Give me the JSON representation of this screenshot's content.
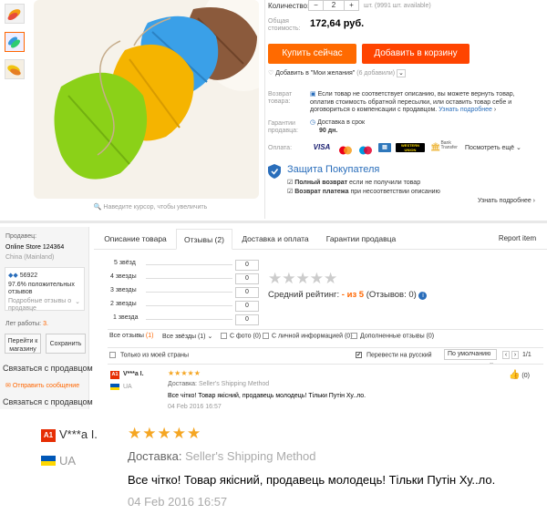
{
  "gallery": {
    "zoom_hint": "Наведите курсор, чтобы увеличить"
  },
  "purchase": {
    "qty_label": "Количество:",
    "qty_value": "2",
    "qty_minus": "−",
    "qty_plus": "+",
    "qty_avail": "шт. (9991 шт. available)",
    "total_label_1": "Общая",
    "total_label_2": "стоимость:",
    "total_value": "172,64 руб.",
    "buy_now": "Купить сейчас",
    "add_to_cart": "Добавить в корзину",
    "wishlist": "Добавить в \"Мои желания\"",
    "wishlist_count": "(6 добавили)",
    "return_label_1": "Возврат",
    "return_label_2": "товара:",
    "return_text_1": "Если товар не соответствует описанию, вы можете вернуть товар,",
    "return_text_2": "оплатив стоимость обратной пересылки, или оставить товар себе и",
    "return_text_3": "договориться о компенсации с продавцом.",
    "return_more": "Узнать подробнее",
    "guarantee_label_1": "Гарантии",
    "guarantee_label_2": "продавца:",
    "guarantee_text": "Доставка в срок",
    "guarantee_days": "90 дн.",
    "payment_label": "Оплата:",
    "payment_more": "Посмотреть ещё",
    "pay_visa": "VISA",
    "pay_wu": "WESTERN UNION",
    "pay_bank": "Bank Transfer",
    "protection_title": "Защита Покупателя",
    "protection_item1_bold": "Полный возврат",
    "protection_item1_rest": "если не получили товар",
    "protection_item2_bold": "Возврат платежа",
    "protection_item2_rest": "при несоответствии описанию",
    "protection_more": "Узнать подробнее"
  },
  "seller": {
    "label": "Продавец:",
    "name": "Online Store 124364",
    "location": "China (Mainland)",
    "score": "56922",
    "positive_pct": "97.6%",
    "positive_text_1": "положительных",
    "positive_text_2": "отзывов",
    "details_1": "Подробные отзывы о",
    "details_2": "продавце",
    "years_label": "Лет работы:",
    "years_value": "3",
    "goto_store_1": "Перейти к",
    "goto_store_2": "магазину",
    "save": "Сохранить",
    "contact": "Связаться с продавцом",
    "send_message": "Отправить сообщение",
    "contact2": "Связаться с продавцом"
  },
  "tabs": {
    "description": "Описание товара",
    "reviews": "Отзывы (2)",
    "shipping": "Доставка и оплата",
    "guarantees": "Гарантии продавца",
    "report": "Report item"
  },
  "ratings": {
    "rows": [
      {
        "label": "5 звёзд",
        "count": "0"
      },
      {
        "label": "4 звезды",
        "count": "0"
      },
      {
        "label": "3 звезды",
        "count": "0"
      },
      {
        "label": "2 звезды",
        "count": "0"
      },
      {
        "label": "1 звезда",
        "count": "0"
      }
    ],
    "average_label": "Средний рейтинг:",
    "average_value": "- из 5",
    "reviews_count": "(Отзывов: 0)"
  },
  "filters": {
    "all": "Все отзывы",
    "all_count": "(1)",
    "all_stars": "Все звёзды",
    "all_stars_count": "(1)",
    "with_photo": "С фото",
    "with_photo_count": "(0)",
    "with_personal": "С личной информацией",
    "with_personal_count": "(0)",
    "extra": "Дополненные отзывы",
    "extra_count": "(0)",
    "my_country": "Только из моей страны",
    "translate": "Перевести на русский",
    "sort": "По умолчанию",
    "page": "1/1"
  },
  "review": {
    "badge": "A1",
    "user": "V***a I.",
    "country": "UA",
    "shipping_label": "Доставка:",
    "shipping_value": "Seller's Shipping Method",
    "text": "Все чітко! Товар якісний, продавець молодець! Тільки Путін Ху..ло.",
    "date": "04 Feb 2016 16:57",
    "likes": "(0)"
  },
  "colors": {
    "accent": "#ff6a00",
    "cart": "#ff4400",
    "link": "#2a6ebb",
    "star": "#f5a623"
  }
}
